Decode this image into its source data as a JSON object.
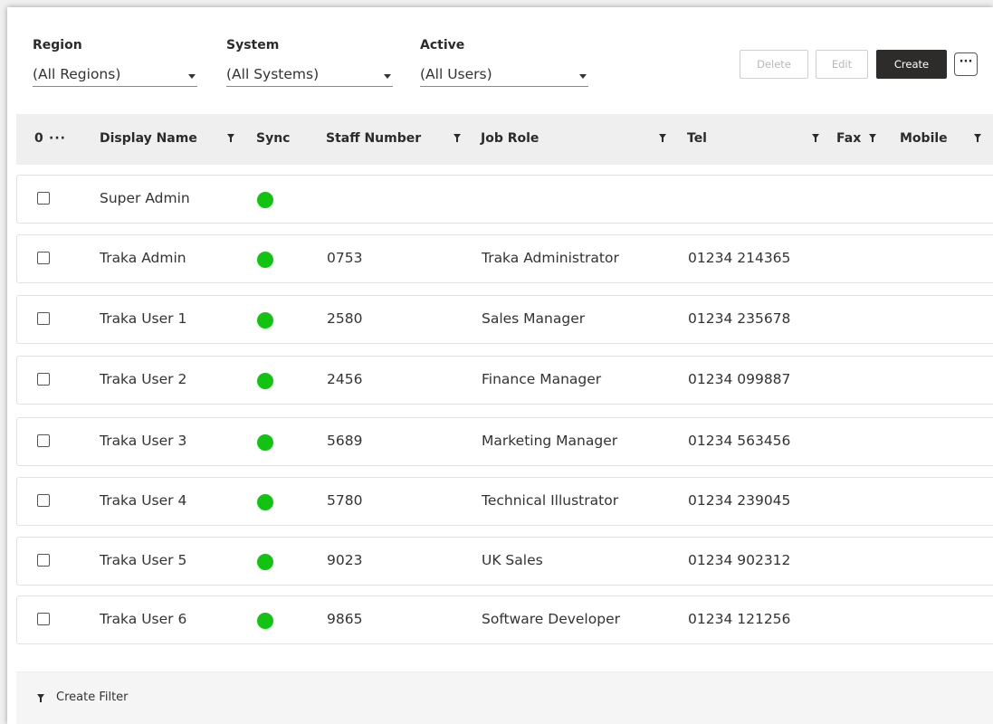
{
  "filters": [
    {
      "label": "Region",
      "value": "(All Regions)"
    },
    {
      "label": "System",
      "value": "(All Systems)"
    },
    {
      "label": "Active",
      "value": "(All Users)"
    }
  ],
  "toolbar": {
    "delete_label": "Delete",
    "edit_label": "Edit",
    "create_label": "Create",
    "more_label": "···"
  },
  "table": {
    "selected_count": "0",
    "select_menu": "···",
    "columns": {
      "display_name": "Display Name",
      "sync": "Sync",
      "staff_number": "Staff Number",
      "job_role": "Job Role",
      "tel": "Tel",
      "fax": "Fax",
      "mobile": "Mobile"
    },
    "rows": [
      {
        "display_name": "Super Admin",
        "synced": true,
        "staff_number": "",
        "job_role": "",
        "tel": ""
      },
      {
        "display_name": "Traka Admin",
        "synced": true,
        "staff_number": "0753",
        "job_role": "Traka Administrator",
        "tel": "01234 214365"
      },
      {
        "display_name": "Traka User 1",
        "synced": true,
        "staff_number": "2580",
        "job_role": "Sales Manager",
        "tel": "01234 235678"
      },
      {
        "display_name": "Traka User 2",
        "synced": true,
        "staff_number": "2456",
        "job_role": "Finance Manager",
        "tel": "01234 099887"
      },
      {
        "display_name": "Traka User 3",
        "synced": true,
        "staff_number": "5689",
        "job_role": "Marketing Manager",
        "tel": "01234 563456"
      },
      {
        "display_name": "Traka User 4",
        "synced": true,
        "staff_number": "5780",
        "job_role": "Technical Illustrator",
        "tel": "01234 239045"
      },
      {
        "display_name": "Traka User 5",
        "synced": true,
        "staff_number": "9023",
        "job_role": "UK Sales",
        "tel": "01234 902312"
      },
      {
        "display_name": "Traka User 6",
        "synced": true,
        "staff_number": "9865",
        "job_role": "Software Developer",
        "tel": "01234 121256"
      }
    ]
  },
  "footer": {
    "create_filter_label": "Create Filter"
  },
  "colors": {
    "sync_on": "#11c411",
    "primary_button": "#2e2c2b",
    "header_bg": "#efefef"
  },
  "icons": {
    "column_filter": "funnel-icon",
    "dropdown": "caret-down-icon",
    "sync_status": "status-dot-icon"
  }
}
